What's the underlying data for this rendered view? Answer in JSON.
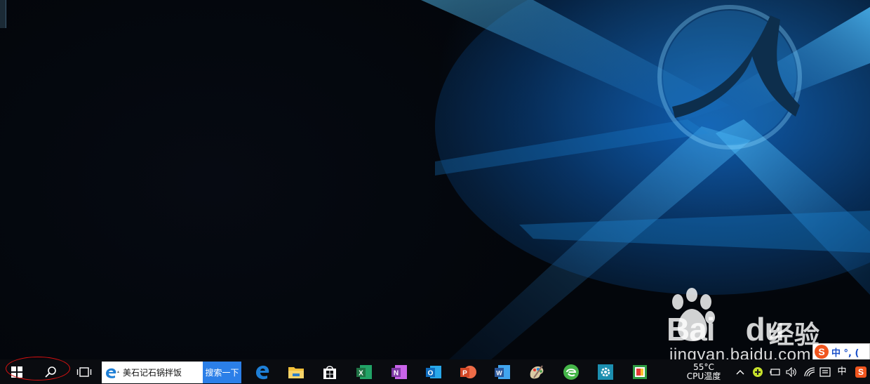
{
  "watermark": {
    "logo_text": "Bai",
    "logo_text_2": "du",
    "brand_cn": "经验",
    "url": "jingyan.baidu.com"
  },
  "ime": {
    "logo": "S",
    "status": "中 °, ("
  },
  "taskbar": {
    "start_icon": "windows-logo-icon",
    "search_icon": "search-icon",
    "task_view_icon": "task-view-icon",
    "ie_search_value": "美石记石锅拌饭",
    "ie_search_button": "搜索一下",
    "apps": [
      {
        "name": "edge",
        "icon": "edge-icon",
        "color": "#1e7fd6"
      },
      {
        "name": "file-explorer",
        "icon": "folder-icon",
        "color": "#f3c13a"
      },
      {
        "name": "store",
        "icon": "store-icon",
        "color": "#ffffff"
      },
      {
        "name": "excel",
        "icon": "excel-icon",
        "color": "#1f7244"
      },
      {
        "name": "onenote",
        "icon": "onenote-icon",
        "color": "#7f3aa6"
      },
      {
        "name": "outlook",
        "icon": "outlook-icon",
        "color": "#0f6cbd"
      },
      {
        "name": "powerpoint",
        "icon": "powerpoint-icon",
        "color": "#d24726"
      },
      {
        "name": "word",
        "icon": "word-icon",
        "color": "#2b579a"
      },
      {
        "name": "paint",
        "icon": "paint-icon",
        "color": "#c9a35a"
      },
      {
        "name": "ie-refresh",
        "icon": "green-e-icon",
        "color": "#45b649"
      },
      {
        "name": "settings",
        "icon": "gear-icon",
        "color": "#1c8fb0"
      },
      {
        "name": "photos",
        "icon": "photo-app-icon",
        "color": "#2f9e44"
      }
    ],
    "cpu_temp_value": "55°C",
    "cpu_temp_label": "CPU温度",
    "ime_mode": "中",
    "tray_sogou": "S"
  },
  "colors": {
    "taskbar_bg": "#0a0c10",
    "search_button_bg": "#2b7fe8",
    "highlight_circle": "#dd1111"
  }
}
